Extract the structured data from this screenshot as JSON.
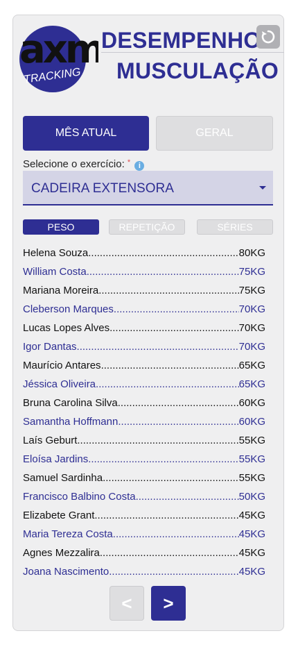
{
  "header": {
    "logo_text": "axm",
    "logo_subtext": "TRACKING",
    "title_line1": "DESEMPENHO",
    "title_line2": "MUSCULAÇÃO",
    "refresh_icon": "refresh-icon"
  },
  "period_buttons": {
    "current_month": "MÊS ATUAL",
    "overall": "GERAL"
  },
  "exercise": {
    "label": "Selecione o exercício:",
    "required_mark": "*",
    "info_glyph": "i",
    "selected": "CADEIRA EXTENSORA"
  },
  "metric_tabs": {
    "weight": "PESO",
    "repetitions": "REPETIÇÃO",
    "sets": "SÉRIES"
  },
  "ranking": [
    {
      "name": "Helena Souza",
      "value": "80KG"
    },
    {
      "name": "William Costa",
      "value": "75KG"
    },
    {
      "name": "Mariana Moreira",
      "value": "75KG"
    },
    {
      "name": "Cleberson Marques",
      "value": "70KG"
    },
    {
      "name": "Lucas Lopes Alves",
      "value": "70KG"
    },
    {
      "name": "Igor Dantas",
      "value": "70KG"
    },
    {
      "name": "Maurício Antares",
      "value": "65KG"
    },
    {
      "name": "Jéssica Oliveira",
      "value": "65KG"
    },
    {
      "name": "Bruna Carolina Silva",
      "value": "60KG"
    },
    {
      "name": "Samantha Hoffmann",
      "value": "60KG"
    },
    {
      "name": "Laís Geburt",
      "value": "55KG"
    },
    {
      "name": "Eloísa Jardins",
      "value": "55KG"
    },
    {
      "name": "Samuel Sardinha",
      "value": "55KG"
    },
    {
      "name": "Francisco Balbino Costa",
      "value": "50KG"
    },
    {
      "name": "Elizabete Grant",
      "value": "45KG"
    },
    {
      "name": "Maria Tereza Costa",
      "value": "45KG"
    },
    {
      "name": "Agnes Mezzalira",
      "value": "45KG"
    },
    {
      "name": "Joana Nascimento",
      "value": "45KG"
    }
  ],
  "pagination": {
    "prev": "<",
    "next": ">"
  },
  "colors": {
    "accent": "#2e2e93",
    "disabled": "#dedee0",
    "card": "#efeff0"
  }
}
